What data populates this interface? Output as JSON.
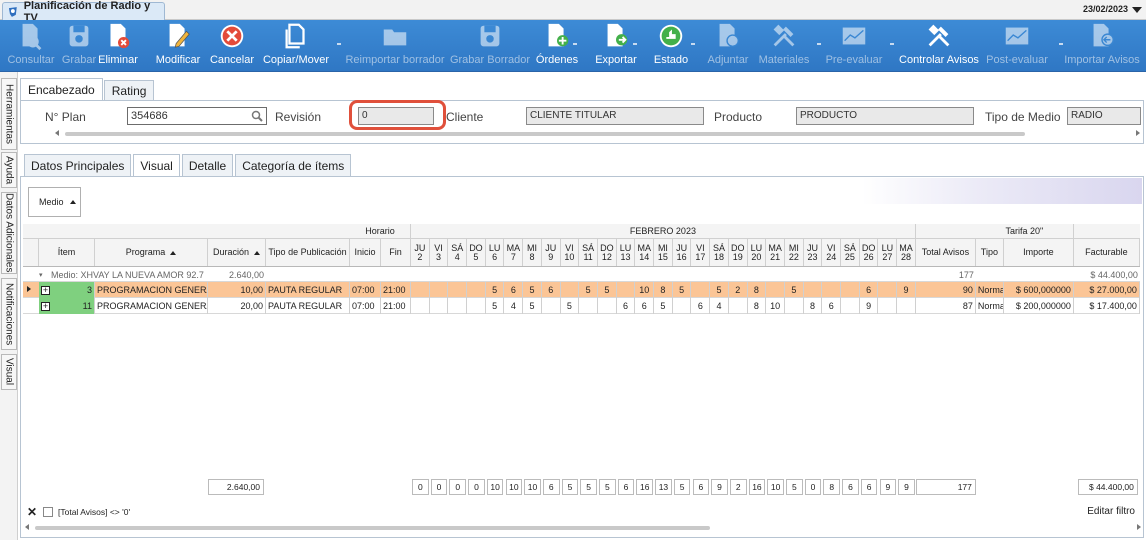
{
  "window": {
    "title": "Planificación de Radio y TV",
    "date": "23/02/2023"
  },
  "toolbar": [
    {
      "label": "Consultar",
      "icon": "search-doc-icon",
      "enabled": false
    },
    {
      "label": "Grabar",
      "icon": "disk-icon",
      "enabled": false
    },
    {
      "label": "Eliminar",
      "icon": "delete-doc-icon",
      "enabled": true
    },
    {
      "label": "Modificar",
      "icon": "edit-doc-icon",
      "enabled": true
    },
    {
      "label": "Cancelar",
      "icon": "cancel-icon",
      "enabled": true
    },
    {
      "label": "Copiar/Mover",
      "icon": "copy-icon",
      "enabled": true
    },
    {
      "label": "Reimportar borrador",
      "icon": "folder-icon",
      "enabled": false
    },
    {
      "label": "Grabar Borrador",
      "icon": "disk-icon",
      "enabled": false
    },
    {
      "label": "Órdenes",
      "icon": "orders-icon",
      "enabled": true
    },
    {
      "label": "Exportar",
      "icon": "export-icon",
      "enabled": true
    },
    {
      "label": "Estado",
      "icon": "status-icon",
      "enabled": true
    },
    {
      "label": "Adjuntar",
      "icon": "attach-icon",
      "enabled": false
    },
    {
      "label": "Materiales",
      "icon": "tools-icon",
      "enabled": false
    },
    {
      "label": "Pre-evaluar",
      "icon": "chart-icon",
      "enabled": false
    },
    {
      "label": "Controlar Avisos",
      "icon": "tools-icon",
      "enabled": true
    },
    {
      "label": "Post-evaluar",
      "icon": "chart-icon",
      "enabled": false
    },
    {
      "label": "Importar Avisos",
      "icon": "import-icon",
      "enabled": false
    }
  ],
  "side_tabs": [
    "Herramientas",
    "Ayuda",
    "Datos Adicionales",
    "Notificaciones",
    "Visual"
  ],
  "header_tabs": [
    "Encabezado",
    "Rating"
  ],
  "header": {
    "plan_label": "N° Plan",
    "plan_value": "354686",
    "revision_label": "Revisión",
    "revision_value": "0",
    "cliente_label": "Cliente",
    "cliente_value": "CLIENTE TITULAR",
    "producto_label": "Producto",
    "producto_value": "PRODUCTO",
    "tipo_medio_label": "Tipo de Medio",
    "tipo_medio_value": "RADIO"
  },
  "main_tabs": [
    "Datos Principales",
    "Visual",
    "Detalle",
    "Categoría de ítems"
  ],
  "grid": {
    "medio_button": "Medio",
    "horario_label": "Horario",
    "month_label": "FEBRERO 2023",
    "tarifa_label": "Tarifa 20\"",
    "headers": {
      "item": "Ítem",
      "programa": "Programa",
      "duracion": "Duración",
      "tipo_pub": "Tipo de Publicación",
      "inicio": "Inicio",
      "fin": "Fin",
      "total": "Total Avisos",
      "tipo": "Tipo",
      "importe": "Importe",
      "facturable": "Facturable"
    },
    "days": [
      {
        "d": "JU",
        "n": "2"
      },
      {
        "d": "VI",
        "n": "3"
      },
      {
        "d": "SÁ",
        "n": "4"
      },
      {
        "d": "DO",
        "n": "5"
      },
      {
        "d": "LU",
        "n": "6"
      },
      {
        "d": "MA",
        "n": "7"
      },
      {
        "d": "MI",
        "n": "8"
      },
      {
        "d": "JU",
        "n": "9"
      },
      {
        "d": "VI",
        "n": "10"
      },
      {
        "d": "SÁ",
        "n": "11"
      },
      {
        "d": "DO",
        "n": "12"
      },
      {
        "d": "LU",
        "n": "13"
      },
      {
        "d": "MA",
        "n": "14"
      },
      {
        "d": "MI",
        "n": "15"
      },
      {
        "d": "JU",
        "n": "16"
      },
      {
        "d": "VI",
        "n": "17"
      },
      {
        "d": "SÁ",
        "n": "18"
      },
      {
        "d": "DO",
        "n": "19"
      },
      {
        "d": "LU",
        "n": "20"
      },
      {
        "d": "MA",
        "n": "21"
      },
      {
        "d": "MI",
        "n": "22"
      },
      {
        "d": "JU",
        "n": "23"
      },
      {
        "d": "VI",
        "n": "24"
      },
      {
        "d": "SÁ",
        "n": "25"
      },
      {
        "d": "DO",
        "n": "26"
      },
      {
        "d": "LU",
        "n": "27"
      },
      {
        "d": "MA",
        "n": "28"
      }
    ],
    "group": {
      "label": "Medio: XHVAY LA NUEVA AMOR 92.7",
      "duracion": "2.640,00",
      "total": "177",
      "facturable": "$ 44.400,00"
    },
    "rows": [
      {
        "item": "3",
        "programa": "PROGRAMACION GENERAL",
        "duracion": "10,00",
        "tipo_pub": "PAUTA REGULAR",
        "inicio": "07:00",
        "fin": "21:00",
        "days": [
          "",
          "",
          "",
          "",
          "5",
          "6",
          "5",
          "6",
          "",
          "5",
          "5",
          "",
          "10",
          "8",
          "5",
          "",
          "5",
          "2",
          "8",
          "",
          "5",
          "",
          "",
          "",
          "6",
          "",
          "9"
        ],
        "total": "90",
        "tipo": "Normal",
        "importe": "$ 600,000000",
        "facturable": "$ 27.000,00",
        "selected": true
      },
      {
        "item": "11",
        "programa": "PROGRAMACION GENERAL",
        "duracion": "20,00",
        "tipo_pub": "PAUTA REGULAR",
        "inicio": "07:00",
        "fin": "21:00",
        "days": [
          "",
          "",
          "",
          "",
          "5",
          "4",
          "5",
          "",
          "5",
          "",
          "",
          "6",
          "6",
          "5",
          "",
          "6",
          "4",
          "",
          "8",
          "10",
          "",
          "8",
          "6",
          "",
          "9",
          "",
          ""
        ],
        "total": "87",
        "tipo": "Normal",
        "importe": "$ 200,000000",
        "facturable": "$ 17.400,00",
        "selected": false
      }
    ],
    "footer": {
      "duracion": "2.640,00",
      "days": [
        "0",
        "0",
        "0",
        "0",
        "10",
        "10",
        "10",
        "6",
        "5",
        "5",
        "5",
        "6",
        "16",
        "13",
        "5",
        "6",
        "9",
        "2",
        "16",
        "10",
        "5",
        "0",
        "8",
        "6",
        "6",
        "9",
        "9"
      ],
      "total": "177",
      "facturable": "$ 44.400,00"
    },
    "filter_text": "[Total Avisos] <> '0'",
    "edit_filter": "Editar filtro"
  }
}
